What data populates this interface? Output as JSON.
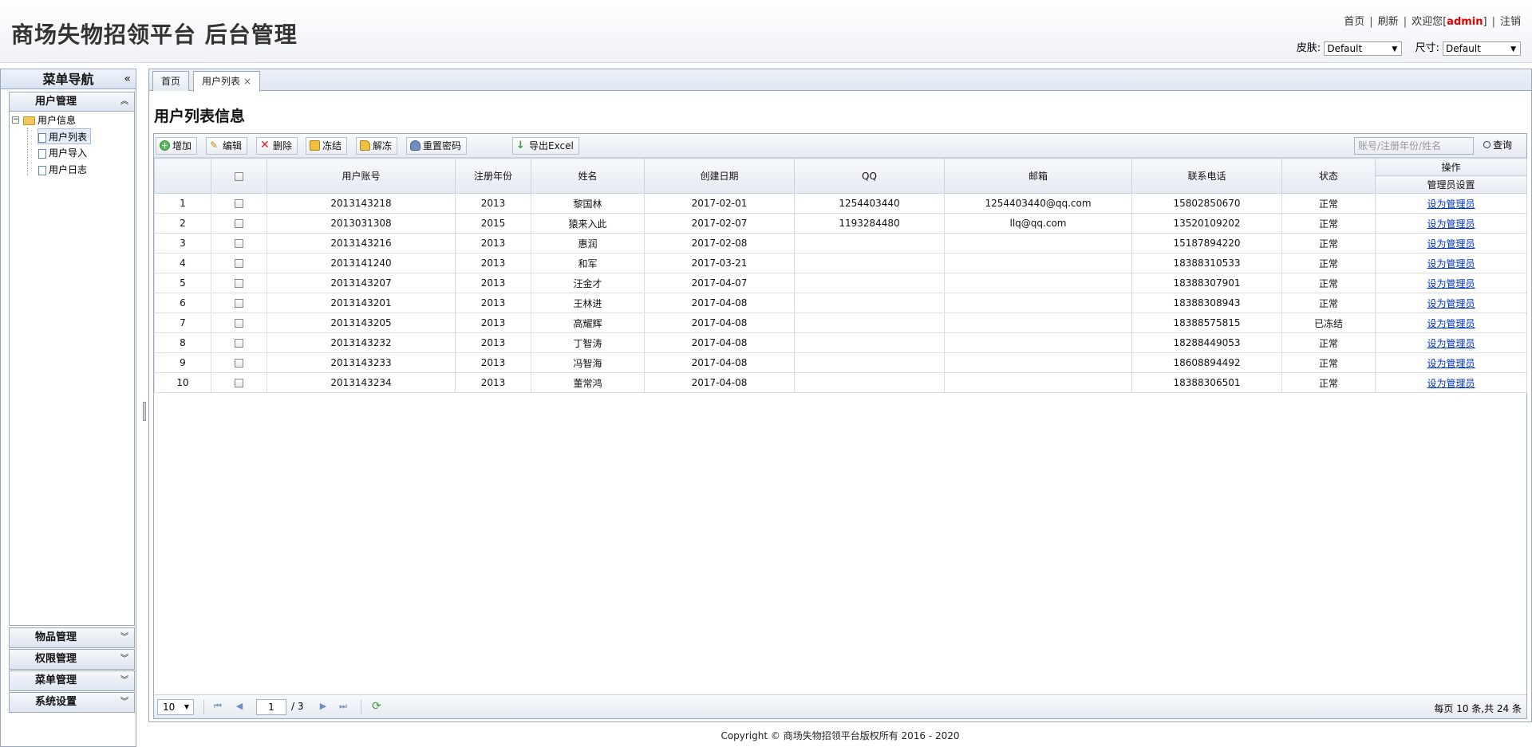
{
  "header": {
    "title": "商场失物招领平台 后台管理",
    "links": {
      "home": "首页",
      "refresh": "刷新",
      "welcome_prefix": "欢迎您[",
      "user": "admin",
      "welcome_suffix": "]",
      "logout": "注销"
    },
    "theme": {
      "skin_label": "皮肤:",
      "skin_value": "Default",
      "size_label": "尺寸:",
      "size_value": "Default"
    }
  },
  "sidebar": {
    "title": "菜单导航",
    "collapse_icon": "«",
    "sections": [
      {
        "label": "用户管理",
        "expanded": true
      },
      {
        "label": "物品管理",
        "expanded": false
      },
      {
        "label": "权限管理",
        "expanded": false
      },
      {
        "label": "菜单管理",
        "expanded": false
      },
      {
        "label": "系统设置",
        "expanded": false
      }
    ],
    "tree": {
      "folder": "用户信息",
      "items": [
        "用户列表",
        "用户导入",
        "用户日志"
      ],
      "selected": "用户列表"
    }
  },
  "tabs": [
    {
      "label": "首页",
      "active": false
    },
    {
      "label": "用户列表",
      "active": true,
      "close": "×"
    }
  ],
  "page_title": "用户列表信息",
  "toolbar": {
    "add": "增加",
    "edit": "编辑",
    "delete": "删除",
    "freeze": "冻结",
    "unfreeze": "解冻",
    "reset_password": "重置密码",
    "export": "导出Excel",
    "search_placeholder": "账号/注册年份/姓名",
    "search": "查询"
  },
  "table": {
    "columns": [
      "用户账号",
      "注册年份",
      "姓名",
      "创建日期",
      "QQ",
      "邮箱",
      "联系电话",
      "状态"
    ],
    "action_group": "操作",
    "action_column": "管理员设置",
    "action_link": "设为管理员",
    "rows": [
      {
        "n": "1",
        "account": "2013143218",
        "year": "2013",
        "name": "黎国林",
        "date": "2017-02-01",
        "qq": "1254403440",
        "email": "1254403440@qq.com",
        "phone": "15802850670",
        "status": "正常"
      },
      {
        "n": "2",
        "account": "2013031308",
        "year": "2015",
        "name": "猿来入此",
        "date": "2017-02-07",
        "qq": "1193284480",
        "email": "llq@qq.com",
        "phone": "13520109202",
        "status": "正常"
      },
      {
        "n": "3",
        "account": "2013143216",
        "year": "2013",
        "name": "惠润",
        "date": "2017-02-08",
        "qq": "",
        "email": "",
        "phone": "15187894220",
        "status": "正常"
      },
      {
        "n": "4",
        "account": "2013141240",
        "year": "2013",
        "name": "和军",
        "date": "2017-03-21",
        "qq": "",
        "email": "",
        "phone": "18388310533",
        "status": "正常"
      },
      {
        "n": "5",
        "account": "2013143207",
        "year": "2013",
        "name": "汪金才",
        "date": "2017-04-07",
        "qq": "",
        "email": "",
        "phone": "18388307901",
        "status": "正常"
      },
      {
        "n": "6",
        "account": "2013143201",
        "year": "2013",
        "name": "王林进",
        "date": "2017-04-08",
        "qq": "",
        "email": "",
        "phone": "18388308943",
        "status": "正常"
      },
      {
        "n": "7",
        "account": "2013143205",
        "year": "2013",
        "name": "高耀辉",
        "date": "2017-04-08",
        "qq": "",
        "email": "",
        "phone": "18388575815",
        "status": "已冻结"
      },
      {
        "n": "8",
        "account": "2013143232",
        "year": "2013",
        "name": "丁智涛",
        "date": "2017-04-08",
        "qq": "",
        "email": "",
        "phone": "18288449053",
        "status": "正常"
      },
      {
        "n": "9",
        "account": "2013143233",
        "year": "2013",
        "name": "冯智海",
        "date": "2017-04-08",
        "qq": "",
        "email": "",
        "phone": "18608894492",
        "status": "正常"
      },
      {
        "n": "10",
        "account": "2013143234",
        "year": "2013",
        "name": "董常鸿",
        "date": "2017-04-08",
        "qq": "",
        "email": "",
        "phone": "18388306501",
        "status": "正常"
      }
    ]
  },
  "pager": {
    "page_size": "10",
    "current_page": "1",
    "total_pages": "/ 3",
    "info": "每页 10 条,共 24 条"
  },
  "footer": "Copyright © 商场失物招领平台版权所有  2016 - 2020",
  "colors": {
    "admin": "#e60000",
    "link": "#0033cc",
    "border": "#9aa8bc"
  }
}
